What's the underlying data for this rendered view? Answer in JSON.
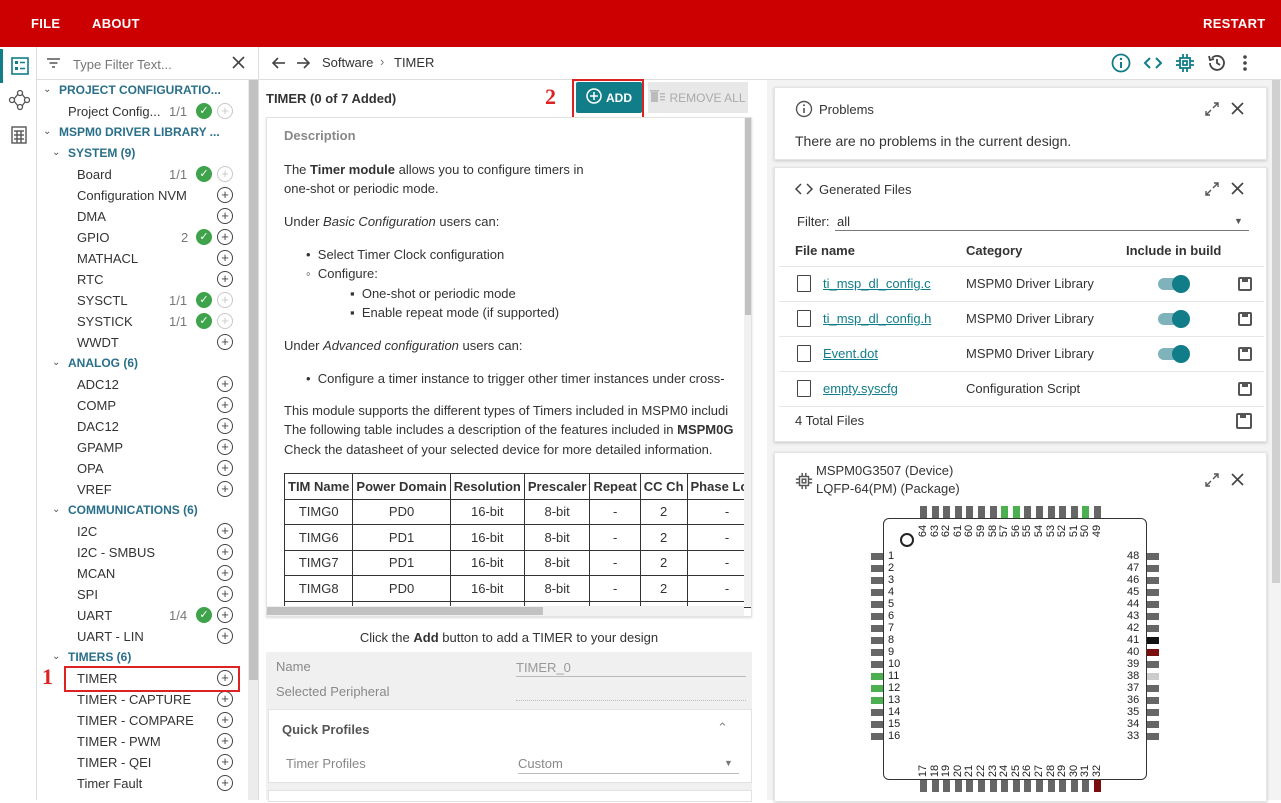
{
  "menu": {
    "file": "FILE",
    "about": "ABOUT",
    "restart": "RESTART"
  },
  "colors": {
    "brand": "#cc0000",
    "accent": "#117d89",
    "ok": "#3ea34a"
  },
  "filter": {
    "placeholder": "Type Filter Text..."
  },
  "tree": {
    "project_header": "PROJECT CONFIGURATIO...",
    "project_config": {
      "label": "Project Config...",
      "count": "1/1"
    },
    "driver_header": "MSPM0 DRIVER LIBRARY ...",
    "system_header": "SYSTEM (9)",
    "system": [
      {
        "label": "Board",
        "count": "1/1"
      },
      {
        "label": "Configuration NVM",
        "count": ""
      },
      {
        "label": "DMA",
        "count": ""
      },
      {
        "label": "GPIO",
        "count": "2"
      },
      {
        "label": "MATHACL",
        "count": ""
      },
      {
        "label": "RTC",
        "count": ""
      },
      {
        "label": "SYSCTL",
        "count": "1/1"
      },
      {
        "label": "SYSTICK",
        "count": "1/1"
      },
      {
        "label": "WWDT",
        "count": ""
      }
    ],
    "analog_header": "ANALOG (6)",
    "analog": [
      "ADC12",
      "COMP",
      "DAC12",
      "GPAMP",
      "OPA",
      "VREF"
    ],
    "comm_header": "COMMUNICATIONS (6)",
    "comm": [
      {
        "label": "I2C",
        "count": ""
      },
      {
        "label": "I2C - SMBUS",
        "count": ""
      },
      {
        "label": "MCAN",
        "count": ""
      },
      {
        "label": "SPI",
        "count": ""
      },
      {
        "label": "UART",
        "count": "1/4"
      },
      {
        "label": "UART - LIN",
        "count": ""
      }
    ],
    "timers_header": "TIMERS (6)",
    "timers": [
      "TIMER",
      "TIMER - CAPTURE",
      "TIMER - COMPARE",
      "TIMER - PWM",
      "TIMER - QEI",
      "Timer Fault"
    ]
  },
  "annotations": {
    "one": "1",
    "two": "2"
  },
  "breadcrumb": {
    "software": "Software",
    "sep": "›",
    "current": "TIMER"
  },
  "module": {
    "title": "TIMER (0 of 7 Added)",
    "add": "ADD",
    "remove_all": "REMOVE ALL",
    "desc_heading": "Description",
    "desc": {
      "l1a": "The ",
      "l1b": "Timer module",
      "l1c": " allows you to configure timers in",
      "l2": "one-shot or periodic mode.",
      "l3a": "Under ",
      "l3b": "Basic Configuration",
      "l3c": " users can:",
      "b1": "Select Timer Clock configuration",
      "b2": "Configure:",
      "b3": "One-shot or periodic mode",
      "b4": "Enable repeat mode (if supported)",
      "l4a": "Under ",
      "l4b": "Advanced configuration",
      "l4c": " users can:",
      "b5": "Configure a timer instance to trigger other timer instances under cross-",
      "l5": "This module supports the different types of Timers included in MSPM0 includi",
      "l6a": "The following table includes a description of the features included in ",
      "l6b": "MSPM0G",
      "l7": "Check the datasheet of your selected device for more detailed information."
    },
    "table": {
      "headers": [
        "TIM Name",
        "Power Domain",
        "Resolution",
        "Prescaler",
        "Repeat",
        "CC Ch",
        "Phase Load"
      ],
      "rows": [
        [
          "TIMG0",
          "PD0",
          "16-bit",
          "8-bit",
          "-",
          "2",
          "-"
        ],
        [
          "TIMG6",
          "PD1",
          "16-bit",
          "8-bit",
          "-",
          "2",
          "-"
        ],
        [
          "TIMG7",
          "PD1",
          "16-bit",
          "8-bit",
          "-",
          "2",
          "-"
        ],
        [
          "TIMG8",
          "PD0",
          "16-bit",
          "8-bit",
          "-",
          "2",
          "-"
        ]
      ]
    },
    "hint_pre": "Click the ",
    "hint_bold": "Add",
    "hint_post": " button to add a TIMER to your design",
    "name_label": "Name",
    "name_value": "TIMER_0",
    "periph_label": "Selected Peripheral",
    "quick_profiles": "Quick Profiles",
    "timer_profiles_label": "Timer Profiles",
    "timer_profiles_value": "Custom"
  },
  "problems": {
    "title": "Problems",
    "message": "There are no problems in the current design."
  },
  "generated": {
    "title": "Generated Files",
    "filter_label": "Filter:",
    "filter_value": "all",
    "headers": {
      "name": "File name",
      "category": "Category",
      "include": "Include in build"
    },
    "files": [
      {
        "name": "ti_msp_dl_config.c",
        "category": "MSPM0 Driver Library",
        "include": true
      },
      {
        "name": "ti_msp_dl_config.h",
        "category": "MSPM0 Driver Library",
        "include": true
      },
      {
        "name": "Event.dot",
        "category": "MSPM0 Driver Library",
        "include": true
      },
      {
        "name": "empty.syscfg",
        "category": "Configuration Script",
        "include": false
      }
    ],
    "total": "4 Total Files"
  },
  "device": {
    "line1": "MSPM0G3507 (Device)",
    "line2": "LQFP-64(PM) (Package)",
    "left_pins": [
      "1",
      "2",
      "3",
      "4",
      "5",
      "6",
      "7",
      "8",
      "9",
      "10",
      "11",
      "12",
      "13",
      "14",
      "15",
      "16"
    ],
    "right_pins": [
      "48",
      "47",
      "46",
      "45",
      "44",
      "43",
      "42",
      "41",
      "40",
      "39",
      "38",
      "37",
      "36",
      "35",
      "34",
      "33"
    ],
    "top_pins": [
      "64",
      "63",
      "62",
      "61",
      "60",
      "59",
      "58",
      "57",
      "56",
      "55",
      "54",
      "53",
      "52",
      "51",
      "50",
      "49"
    ],
    "bottom_pins": [
      "17",
      "18",
      "19",
      "20",
      "21",
      "22",
      "23",
      "24",
      "25",
      "26",
      "27",
      "28",
      "29",
      "30",
      "31",
      "32"
    ],
    "green_pins": [
      "11",
      "12",
      "13",
      "56",
      "57",
      "50"
    ],
    "black_pins": [
      "41"
    ],
    "darkred_pins": [
      "40",
      "32"
    ],
    "light_pins": [
      "38"
    ]
  }
}
